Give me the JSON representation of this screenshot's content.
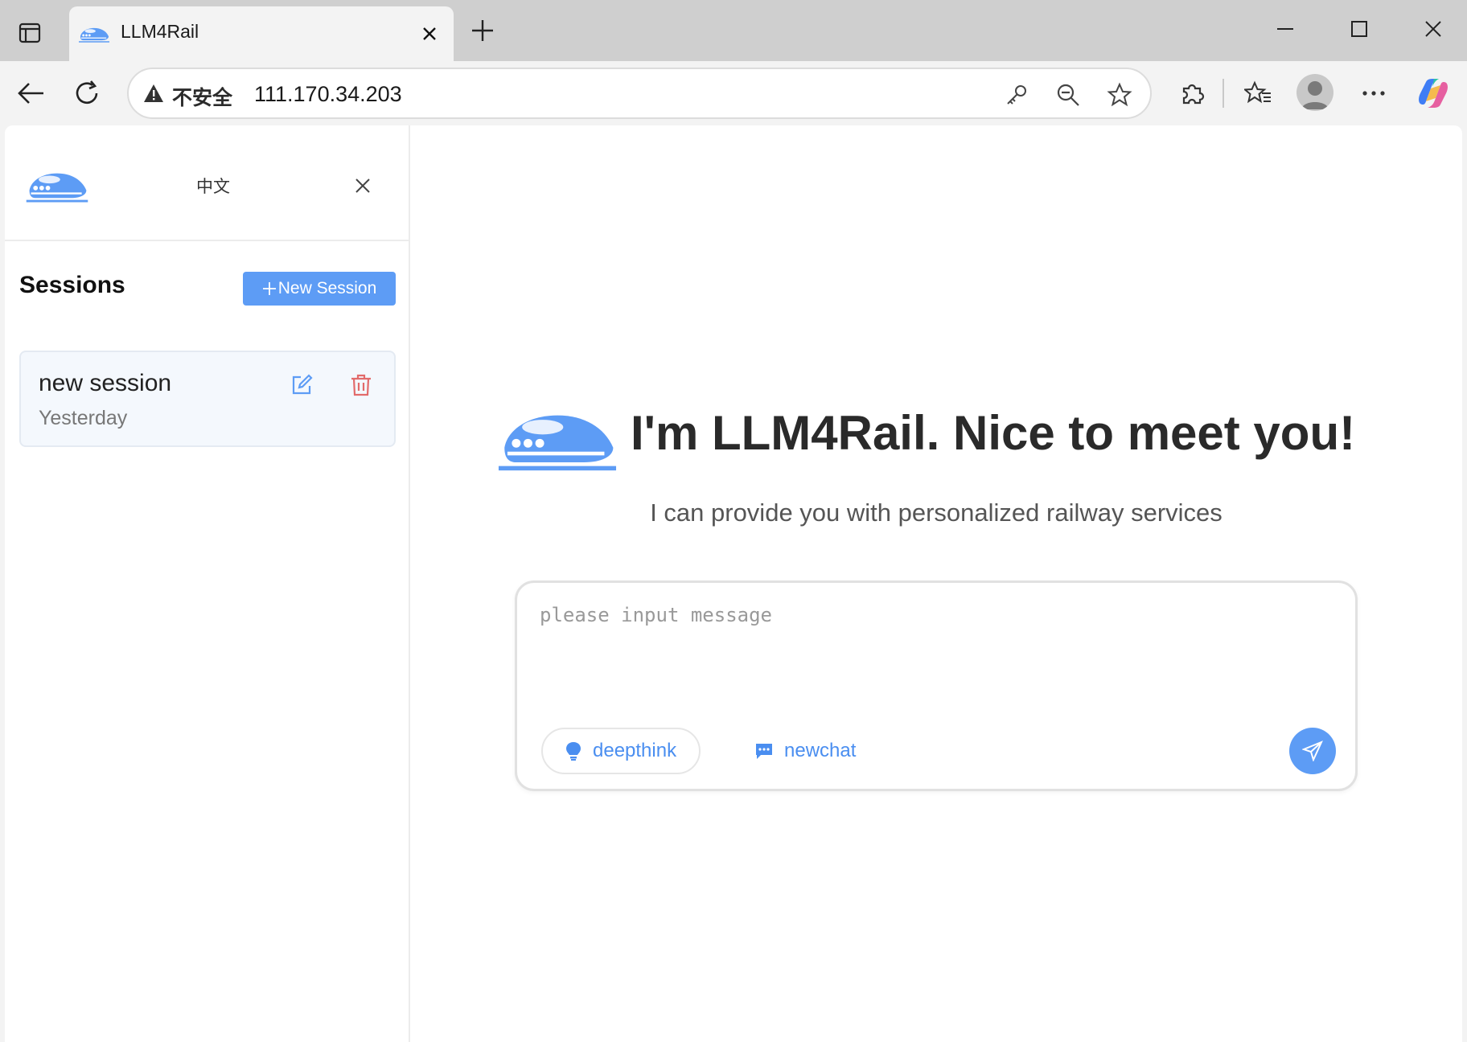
{
  "browser": {
    "tab_title": "LLM4Rail",
    "security_label": "不安全",
    "url": "111.170.34.203"
  },
  "sidebar": {
    "language": "中文",
    "sessions_title": "Sessions",
    "new_session_label": "New Session",
    "sessions": [
      {
        "name": "new session",
        "time": "Yesterday"
      }
    ]
  },
  "main": {
    "title": "I'm LLM4Rail. Nice to meet you!",
    "subtitle": "I can provide you with personalized railway services",
    "input_placeholder": "please input message",
    "deepthink_label": "deepthink",
    "newchat_label": "newchat"
  },
  "colors": {
    "accent": "#5d9cf5",
    "delete": "#e26b6b"
  }
}
